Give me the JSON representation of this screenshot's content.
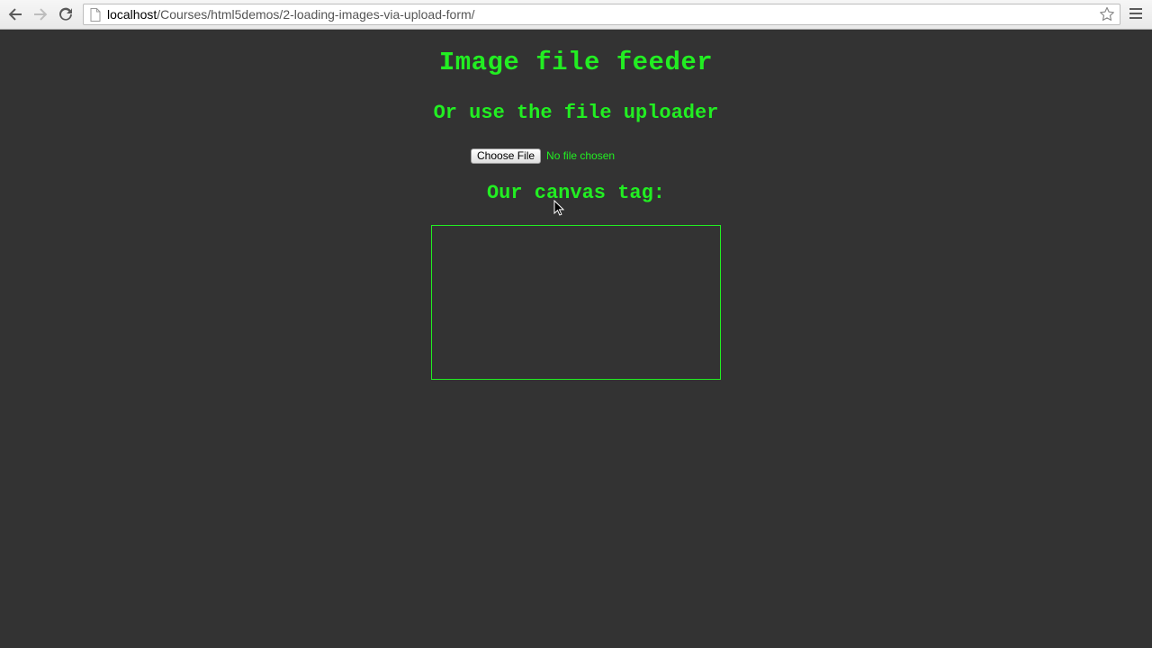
{
  "browser": {
    "url_host": "localhost",
    "url_path": "/Courses/html5demos/2-loading-images-via-upload-form/",
    "icons": {
      "back": "arrow-left-icon",
      "forward": "arrow-right-icon",
      "reload": "reload-icon",
      "page": "page-icon",
      "bookmark": "star-icon",
      "menu": "hamburger-menu-icon"
    }
  },
  "page": {
    "title": "Image file feeder",
    "uploader_heading": "Or use the file uploader",
    "choose_file_label": "Choose File",
    "file_status": "No file chosen",
    "canvas_heading": "Our canvas tag:"
  },
  "colors": {
    "background": "#333333",
    "accent_green": "#22ee22"
  }
}
